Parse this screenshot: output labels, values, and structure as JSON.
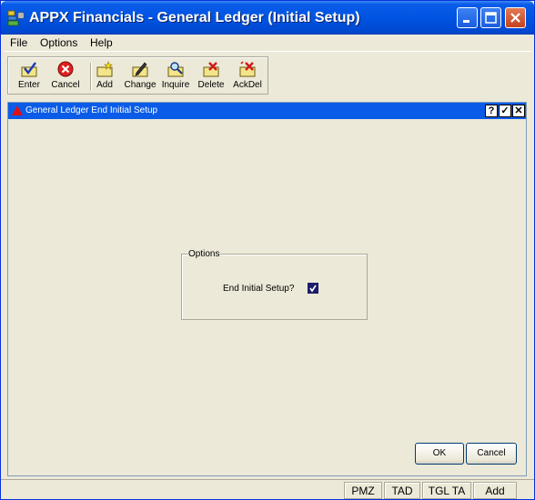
{
  "window": {
    "title": "APPX Financials - General Ledger (Initial Setup)"
  },
  "menubar": {
    "items": [
      "File",
      "Options",
      "Help"
    ]
  },
  "toolbar": {
    "tools": [
      {
        "label": "Enter",
        "icon": "enter-icon"
      },
      {
        "label": "Cancel",
        "icon": "cancel-icon"
      },
      {
        "label": "Add",
        "icon": "add-icon"
      },
      {
        "label": "Change",
        "icon": "change-icon"
      },
      {
        "label": "Inquire",
        "icon": "inquire-icon"
      },
      {
        "label": "Delete",
        "icon": "delete-icon"
      },
      {
        "label": "AckDel",
        "icon": "ackdel-icon"
      }
    ]
  },
  "inner": {
    "title": "General Ledger End Initial Setup",
    "buttons": {
      "help": "?",
      "check": "✓",
      "close": "✕"
    },
    "group": {
      "legend": "Options",
      "field_label": "End Initial Setup?",
      "checked": true
    },
    "ok_label": "OK",
    "cancel_label": "Cancel"
  },
  "statusbar": {
    "cells": [
      "PMZ",
      "TAD",
      "TGL TA",
      "Add"
    ]
  },
  "colors": {
    "titlebar": "#0054e3",
    "inner_titlebar": "#0a5ce8",
    "face": "#ece9d8",
    "close_button": "#c4421f"
  }
}
